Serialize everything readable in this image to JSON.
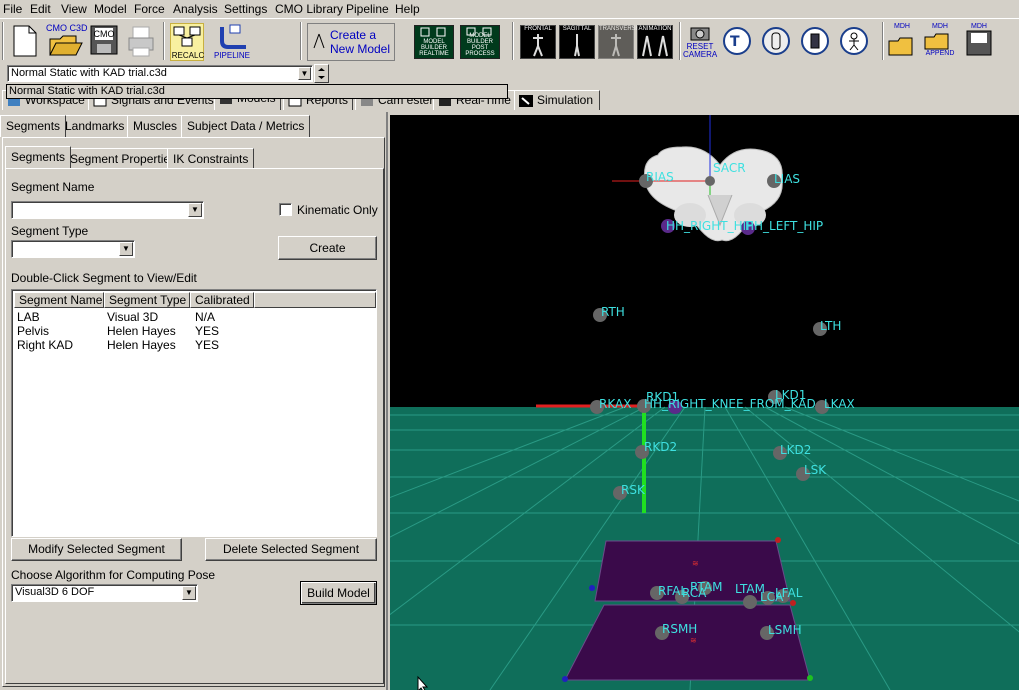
{
  "menu": [
    "File",
    "Edit",
    "View",
    "Model",
    "Force",
    "Analysis",
    "Settings",
    "CMO Library",
    "Pipeline",
    "Help"
  ],
  "toolbar": {
    "cmo_c3d": "CMO C3D",
    "cmo": "CMO",
    "recalc": "RECALC",
    "pipeline": "PIPELINE",
    "create_new_model": [
      "Create a",
      "New Model"
    ],
    "mb_realtime": [
      "MODEL",
      "BUILDER",
      "REALTIME"
    ],
    "mb_post": [
      "MODEL",
      "BUILDER",
      "POST",
      "PROCESS"
    ],
    "frontal": "FRONTAL",
    "sagittal": "SAGITTAL",
    "transverse": "TRANSVERSE",
    "animation": "ANIMATION",
    "reset_camera": [
      "RESET",
      "CAMERA"
    ],
    "mdh": "MDH",
    "mdh_append": [
      "MDH",
      "APPEND"
    ],
    "mdh_save": "MDH"
  },
  "file_combo": {
    "value": "Normal Static with KAD trial.c3d",
    "tooltip": "Normal Static with KAD trial.c3d"
  },
  "top_tabs": [
    "Workspace",
    "Signals and Events",
    "Models",
    "Reports",
    "Cam ester",
    "Real-Time",
    "Simulation"
  ],
  "left_tabs": [
    "Segments",
    "Landmarks",
    "Muscles",
    "Subject Data / Metrics"
  ],
  "inner_tabs": [
    "Segments",
    "Segment Properties",
    "IK Constraints"
  ],
  "segment_form": {
    "segment_name_label": "Segment Name",
    "segment_name_value": "",
    "kinematic_only_label": "Kinematic Only",
    "kinematic_only_checked": false,
    "segment_type_label": "Segment Type",
    "segment_type_value": "",
    "create_label": "Create",
    "list_caption": "Double-Click Segment to View/Edit"
  },
  "segment_table": {
    "headers": [
      "Segment Name",
      "Segment Type",
      "Calibrated"
    ],
    "rows": [
      [
        "LAB",
        "Visual 3D",
        "N/A"
      ],
      [
        "Pelvis",
        "Helen Hayes",
        "YES"
      ],
      [
        "Right KAD",
        "Helen Hayes",
        "YES"
      ]
    ]
  },
  "actions": {
    "modify": "Modify Selected Segment",
    "delete": "Delete Selected Segment",
    "algorithm_label": "Choose Algorithm for Computing Pose",
    "algorithm_value": "Visual3D 6 DOF",
    "build_model": "Build Model"
  },
  "viewport": {
    "sky_color": "#000000",
    "floor_color": "#0f6e5a",
    "plate_color": "#3a0a4a",
    "markers": [
      "RIAS",
      "SACR",
      "LIAS",
      "HH_RIGHT_HIP",
      "HH_LEFT_HIP",
      "RTH",
      "LTH",
      "RKAX",
      "RKD1",
      "HH_RIGHT_KNEE_FROM_KAD",
      "LKD1",
      "LKAX",
      "RKD2",
      "LKD2",
      "LSK",
      "RSK",
      "RFAL",
      "RCA",
      "RTAM",
      "LTAM",
      "LCA",
      "LFAL",
      "RSMH",
      "LSMH"
    ]
  }
}
